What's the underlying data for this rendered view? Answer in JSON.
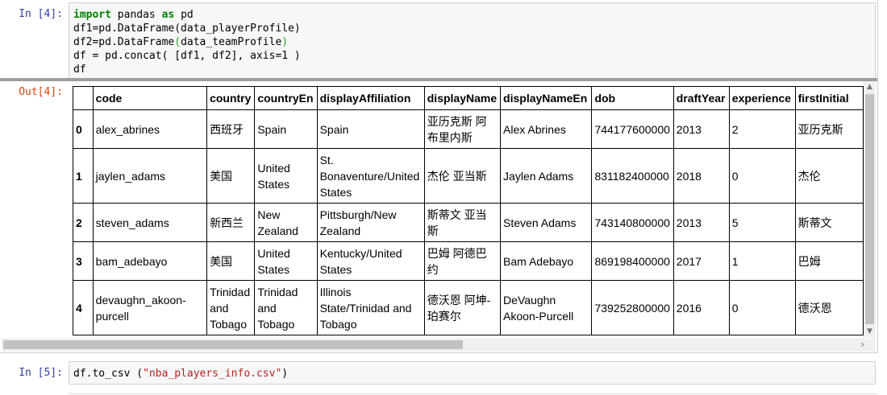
{
  "cells": [
    {
      "prompt": "In [4]:",
      "code_lines": [
        "import pandas as pd",
        "df1=pd.DataFrame(data_playerProfile)",
        "df2=pd.DataFrame(data_teamProfile)",
        "df = pd.concat( [df1, df2], axis=1 )",
        "df"
      ]
    },
    {
      "prompt": "In [5]:",
      "code_lines": [
        "df.to_csv (\"nba_players_info.csv\")"
      ]
    }
  ],
  "output": {
    "prompt": "Out[4]:",
    "columns": [
      "code",
      "country",
      "countryEn",
      "displayAffiliation",
      "displayName",
      "displayNameEn",
      "dob",
      "draftYear",
      "experience",
      "firstInitial"
    ],
    "rows": [
      {
        "index": "0",
        "cells": [
          "alex_abrines",
          "西班牙",
          "Spain",
          "Spain",
          "亚历克斯 阿布里内斯",
          "Alex Abrines",
          "744177600000",
          "2013",
          "2",
          "亚历克斯"
        ]
      },
      {
        "index": "1",
        "cells": [
          "jaylen_adams",
          "美国",
          "United States",
          "St. Bonaventure/United States",
          "杰伦 亚当斯",
          "Jaylen Adams",
          "831182400000",
          "2018",
          "0",
          "杰伦"
        ]
      },
      {
        "index": "2",
        "cells": [
          "steven_adams",
          "新西兰",
          "New Zealand",
          "Pittsburgh/New Zealand",
          "斯蒂文 亚当斯",
          "Steven Adams",
          "743140800000",
          "2013",
          "5",
          "斯蒂文"
        ]
      },
      {
        "index": "3",
        "cells": [
          "bam_adebayo",
          "美国",
          "United States",
          "Kentucky/United States",
          "巴姆 阿德巴约",
          "Bam Adebayo",
          "869198400000",
          "2017",
          "1",
          "巴姆"
        ]
      },
      {
        "index": "4",
        "cells": [
          "devaughn_akoon-purcell",
          "Trinidad and Tobago",
          "Trinidad and Tobago",
          "Illinois State/Trinidad and Tobago",
          "德沃恩 阿坤-珀赛尔",
          "DeVaughn Akoon-Purcell",
          "739252800000",
          "2016",
          "0",
          "德沃恩"
        ]
      }
    ]
  },
  "scrollbars": {
    "up_arrow": "▲",
    "down_arrow": "▼",
    "right_arrow": "›"
  }
}
